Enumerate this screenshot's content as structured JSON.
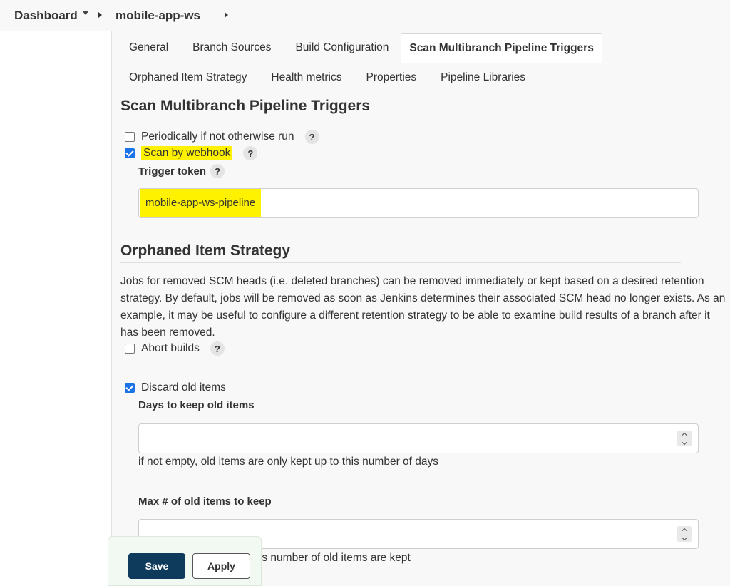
{
  "breadcrumb": {
    "dashboard": "Dashboard",
    "job": "mobile-app-ws"
  },
  "tabs": {
    "row1": [
      "General",
      "Branch Sources",
      "Build Configuration",
      "Scan Multibranch Pipeline Triggers"
    ],
    "row2": [
      "Orphaned Item Strategy",
      "Health metrics",
      "Properties",
      "Pipeline Libraries"
    ],
    "active": "Scan Multibranch Pipeline Triggers"
  },
  "triggers": {
    "title": "Scan Multibranch Pipeline Triggers",
    "periodically_label": "Periodically if not otherwise run",
    "periodically_checked": false,
    "webhook_label": "Scan by webhook",
    "webhook_checked": true,
    "token_label": "Trigger token",
    "token_value": "mobile-app-ws-pipeline"
  },
  "orphaned": {
    "title": "Orphaned Item Strategy",
    "description": "Jobs for removed SCM heads (i.e. deleted branches) can be removed immediately or kept based on a desired retention strategy. By default, jobs will be removed as soon as Jenkins determines their associated SCM head no longer exists. As an example, it may be useful to configure a different retention strategy to be able to examine build results of a branch after it has been removed.",
    "abort_label": "Abort builds",
    "abort_checked": false,
    "discard_label": "Discard old items",
    "discard_checked": true,
    "days_label": "Days to keep old items",
    "days_value": "",
    "days_hint": "if not empty, old items are only kept up to this number of days",
    "max_label": "Max # of old items to keep",
    "max_value": "",
    "max_hint_tail": "this number of old items are kept"
  },
  "help_glyph": "?",
  "buttons": {
    "save": "Save",
    "apply": "Apply"
  },
  "colors": {
    "highlight": "#fff200",
    "checkbox_checked": "#1a73e8",
    "save_button": "#0e3a5c"
  }
}
